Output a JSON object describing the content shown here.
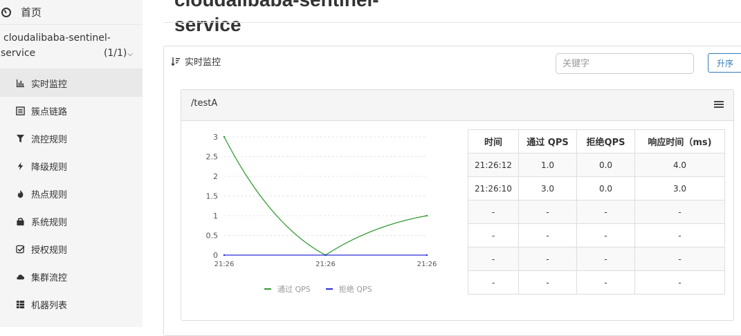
{
  "sidebar": {
    "home_label": "首页",
    "app_name_line1": "cloudalibaba-sentinel-",
    "app_name_line2": "service",
    "app_count": "(1/1)",
    "items": [
      {
        "label": "实时监控",
        "icon": "bar-chart-icon",
        "active": true
      },
      {
        "label": "簇点链路",
        "icon": "list-icon",
        "active": false
      },
      {
        "label": "流控规则",
        "icon": "filter-icon",
        "active": false
      },
      {
        "label": "降级规则",
        "icon": "bolt-icon",
        "active": false
      },
      {
        "label": "热点规则",
        "icon": "fire-icon",
        "active": false
      },
      {
        "label": "系统规则",
        "icon": "lock-icon",
        "active": false
      },
      {
        "label": "授权规则",
        "icon": "check-icon",
        "active": false
      },
      {
        "label": "集群流控",
        "icon": "cloud-icon",
        "active": false
      },
      {
        "label": "机器列表",
        "icon": "grid-icon",
        "active": false
      }
    ]
  },
  "page": {
    "title_line1": "cloudalibaba-sentinel-",
    "title_line2": "service"
  },
  "panel": {
    "heading": "实时监控",
    "search_placeholder": "关键字",
    "sort_label": "升序"
  },
  "card": {
    "resource": "/testA"
  },
  "table": {
    "headers": [
      "时间",
      "通过 QPS",
      "拒绝QPS",
      "响应时间（ms)"
    ],
    "rows": [
      [
        "21:26:12",
        "1.0",
        "0.0",
        "4.0"
      ],
      [
        "21:26:10",
        "3.0",
        "0.0",
        "3.0"
      ],
      [
        "-",
        "-",
        "-",
        "-"
      ],
      [
        "-",
        "-",
        "-",
        "-"
      ],
      [
        "-",
        "-",
        "-",
        "-"
      ],
      [
        "-",
        "-",
        "-",
        "-"
      ]
    ]
  },
  "chart_data": {
    "type": "line",
    "x": [
      "21:26",
      "21:26",
      "21:26"
    ],
    "y_ticks": [
      "3",
      "2.5",
      "2",
      "1.5",
      "1",
      "0.5",
      "0"
    ],
    "ylim": [
      0,
      3
    ],
    "series": [
      {
        "name": "通过 QPS",
        "color": "#2f9a2f",
        "values": [
          3,
          0,
          1
        ]
      },
      {
        "name": "拒绝 QPS",
        "color": "#2b2bd9",
        "values": [
          0,
          0,
          0
        ]
      }
    ],
    "grid": true
  }
}
